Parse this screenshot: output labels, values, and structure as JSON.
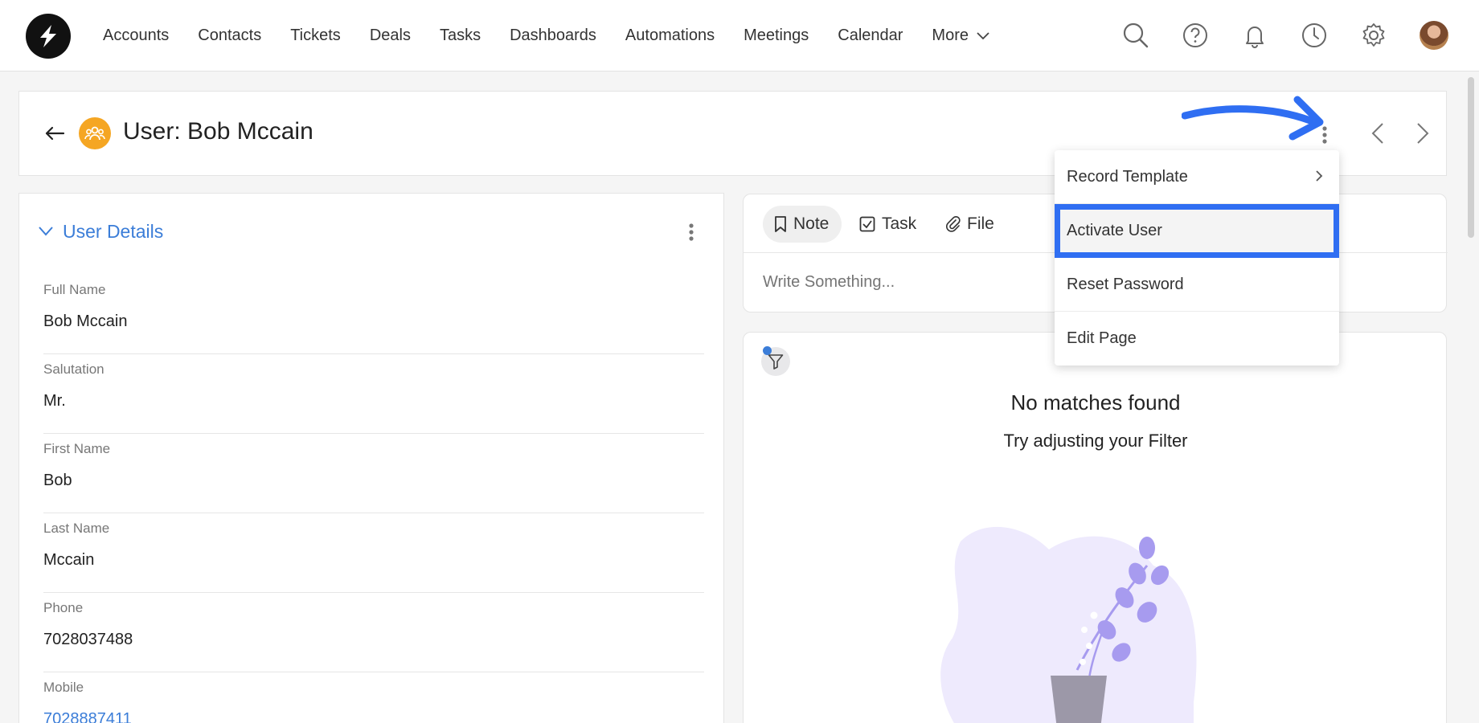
{
  "nav": {
    "items": [
      {
        "label": "Accounts"
      },
      {
        "label": "Contacts"
      },
      {
        "label": "Tickets"
      },
      {
        "label": "Deals"
      },
      {
        "label": "Tasks"
      },
      {
        "label": "Dashboards"
      },
      {
        "label": "Automations"
      },
      {
        "label": "Meetings"
      },
      {
        "label": "Calendar"
      }
    ],
    "more_label": "More",
    "icons": [
      "search-icon",
      "help-icon",
      "bell-icon",
      "clock-icon",
      "gear-icon"
    ]
  },
  "header": {
    "title": "User: Bob Mccain"
  },
  "details": {
    "section_title": "User Details",
    "fields": [
      {
        "label": "Full Name",
        "value": "Bob Mccain"
      },
      {
        "label": "Salutation",
        "value": "Mr."
      },
      {
        "label": "First Name",
        "value": "Bob"
      },
      {
        "label": "Last Name",
        "value": "Mccain"
      },
      {
        "label": "Phone",
        "value": "7028037488"
      },
      {
        "label": "Mobile",
        "value": "7028887411"
      }
    ]
  },
  "composer": {
    "tabs": [
      {
        "label": "Note"
      },
      {
        "label": "Task"
      },
      {
        "label": "File"
      }
    ],
    "placeholder": "Write Something..."
  },
  "timeline": {
    "empty_title": "No matches found",
    "empty_subtitle": "Try adjusting your Filter"
  },
  "menu": {
    "items": [
      {
        "label": "Record Template"
      },
      {
        "label": "Activate User"
      },
      {
        "label": "Reset Password"
      },
      {
        "label": "Edit Page"
      }
    ]
  },
  "colors": {
    "accent": "#3b7dd8",
    "highlight_border": "#2f6ef2",
    "user_badge": "#f5a623",
    "illustration": "#a79bef"
  }
}
